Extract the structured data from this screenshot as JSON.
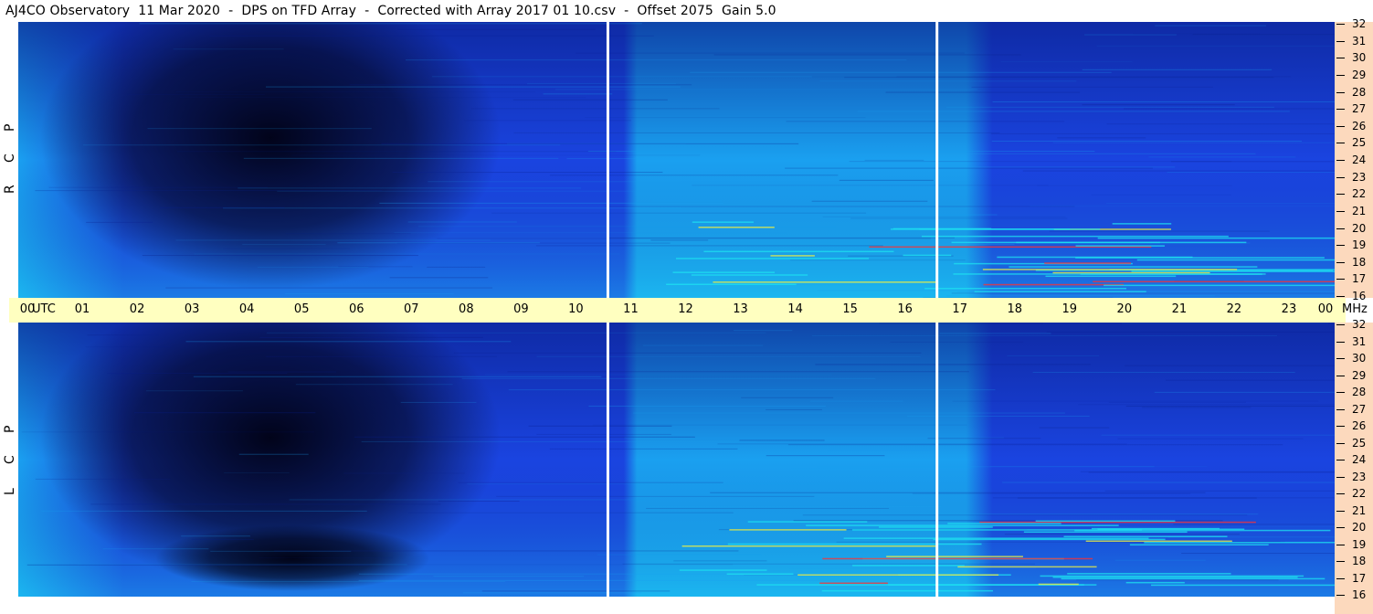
{
  "title": "AJ4CO Observatory  11 Mar 2020  -  DPS on TFD Array  -  Corrected with Array 2017 01 10.csv  -  Offset 2075  Gain 5.0",
  "colors": {
    "deep": "#000010",
    "dark": "#0a1f8c",
    "mid": "#1a44e0",
    "light": "#1aa0f0",
    "cyan": "#1ee0f0",
    "yellow": "#f0f040",
    "red": "#ff3030",
    "time_axis_bg": "#ffffc0",
    "freq_axis_bg": "#fcd9bd"
  },
  "chart_data": {
    "type": "heatmap",
    "x_axis": {
      "unit_label": "UTC",
      "ticks": [
        "00",
        "01",
        "02",
        "03",
        "04",
        "05",
        "06",
        "07",
        "08",
        "09",
        "10",
        "11",
        "12",
        "13",
        "14",
        "15",
        "16",
        "17",
        "18",
        "19",
        "20",
        "21",
        "22",
        "23",
        "00"
      ],
      "range": [
        0,
        24
      ]
    },
    "y_axis": {
      "unit_label": "MHz",
      "ticks": [
        "16",
        "17",
        "18",
        "19",
        "20",
        "21",
        "22",
        "23",
        "24",
        "25",
        "26",
        "27",
        "28",
        "29",
        "30",
        "31",
        "32"
      ],
      "range": [
        16,
        32
      ]
    },
    "panels": [
      {
        "name": "RCP",
        "label_letters": [
          "R",
          "C",
          "P"
        ]
      },
      {
        "name": "LCP",
        "label_letters": [
          "L",
          "C",
          "P"
        ]
      }
    ],
    "dividers_utc": [
      10.75,
      16.75
    ]
  }
}
